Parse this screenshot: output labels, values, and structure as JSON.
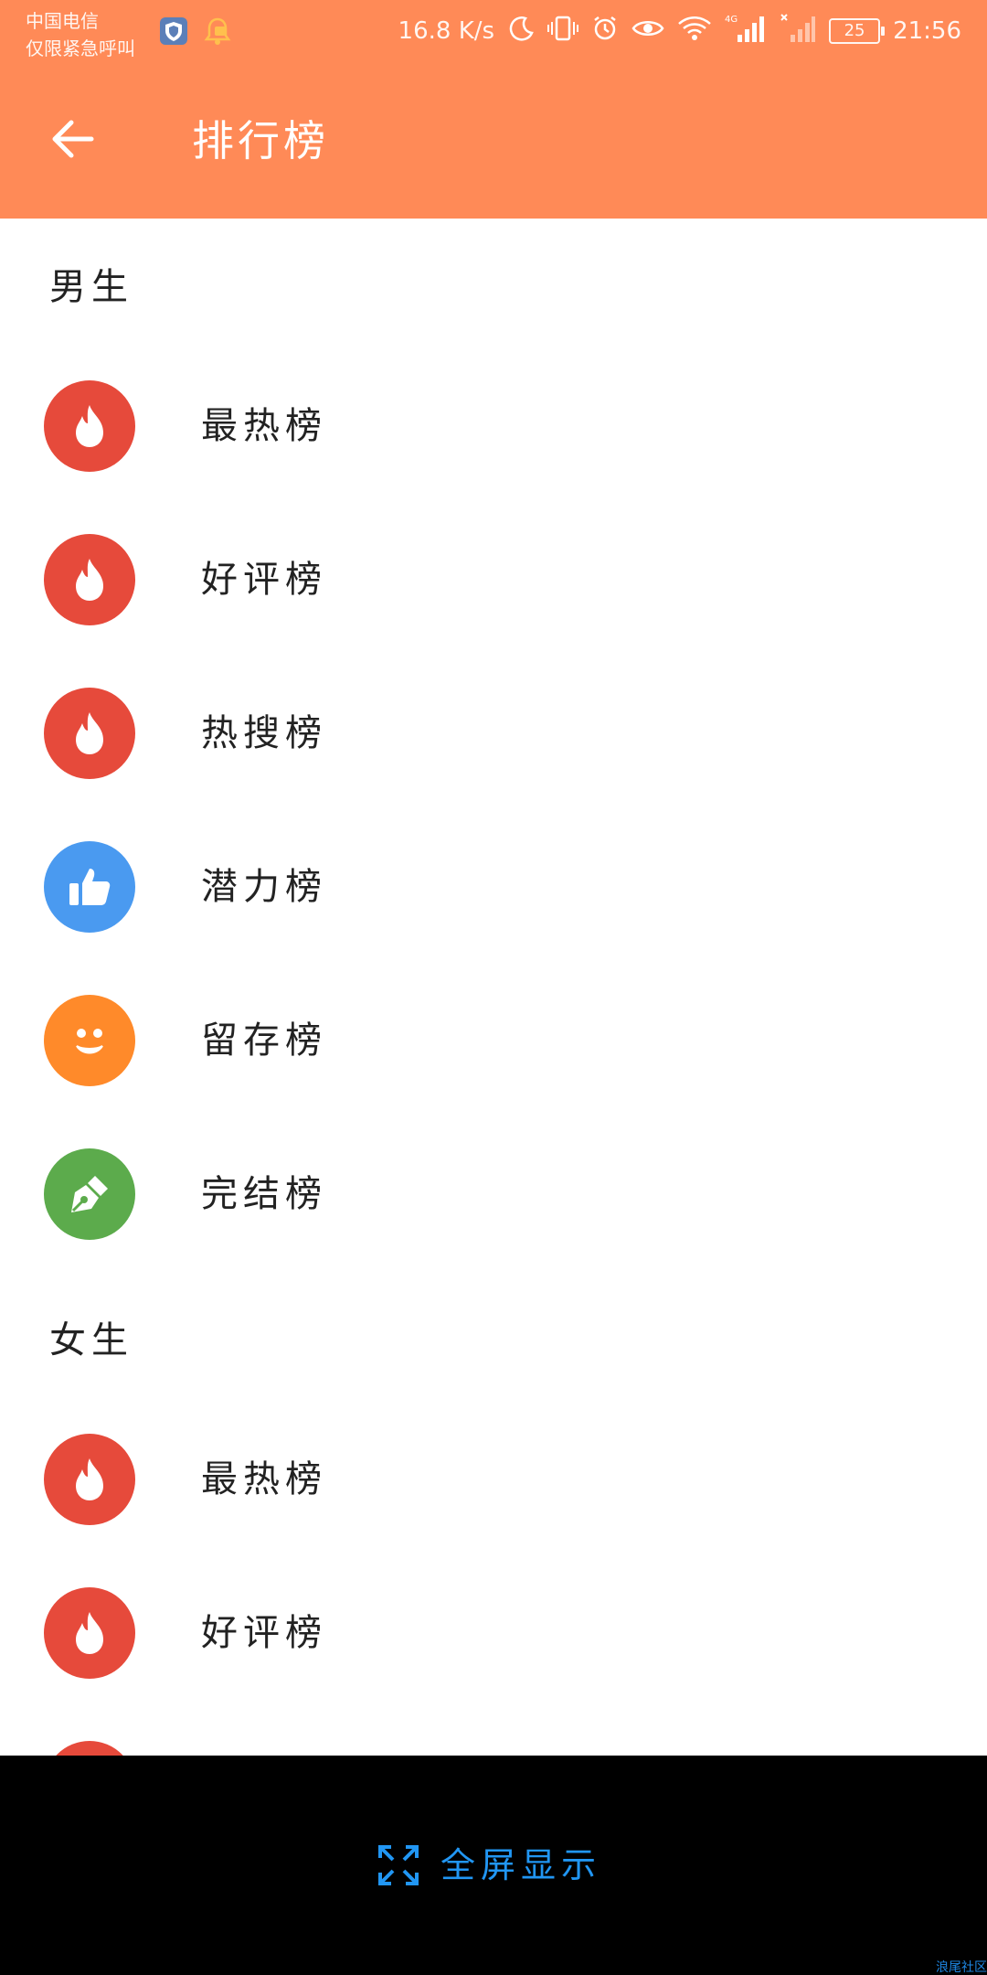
{
  "status_bar": {
    "carrier_line1": "中国电信",
    "carrier_line2": "仅限紧急呼叫",
    "network_speed": "16.8 K/s",
    "network_type": "4G",
    "battery_level": "25",
    "time": "21:56"
  },
  "app_bar": {
    "title": "排行榜"
  },
  "sections": [
    {
      "header": "男生",
      "items": [
        {
          "label": "最热榜",
          "icon": "flame-icon",
          "color": "#e64a3b"
        },
        {
          "label": "好评榜",
          "icon": "flame-icon",
          "color": "#e64a3b"
        },
        {
          "label": "热搜榜",
          "icon": "flame-icon",
          "color": "#e64a3b"
        },
        {
          "label": "潜力榜",
          "icon": "thumbs-up-icon",
          "color": "#4a9af0"
        },
        {
          "label": "留存榜",
          "icon": "smiley-icon",
          "color": "#ff8a2a"
        },
        {
          "label": "完结榜",
          "icon": "pen-nib-icon",
          "color": "#5cab4c"
        }
      ]
    },
    {
      "header": "女生",
      "items": [
        {
          "label": "最热榜",
          "icon": "flame-icon",
          "color": "#e64a3b"
        },
        {
          "label": "好评榜",
          "icon": "flame-icon",
          "color": "#e64a3b"
        }
      ]
    }
  ],
  "bottom_bar": {
    "fullscreen_label": "全屏显示",
    "watermark": "浪尾社区"
  },
  "colors": {
    "header_orange": "#ff8a57",
    "accent_blue": "#2196f3"
  }
}
